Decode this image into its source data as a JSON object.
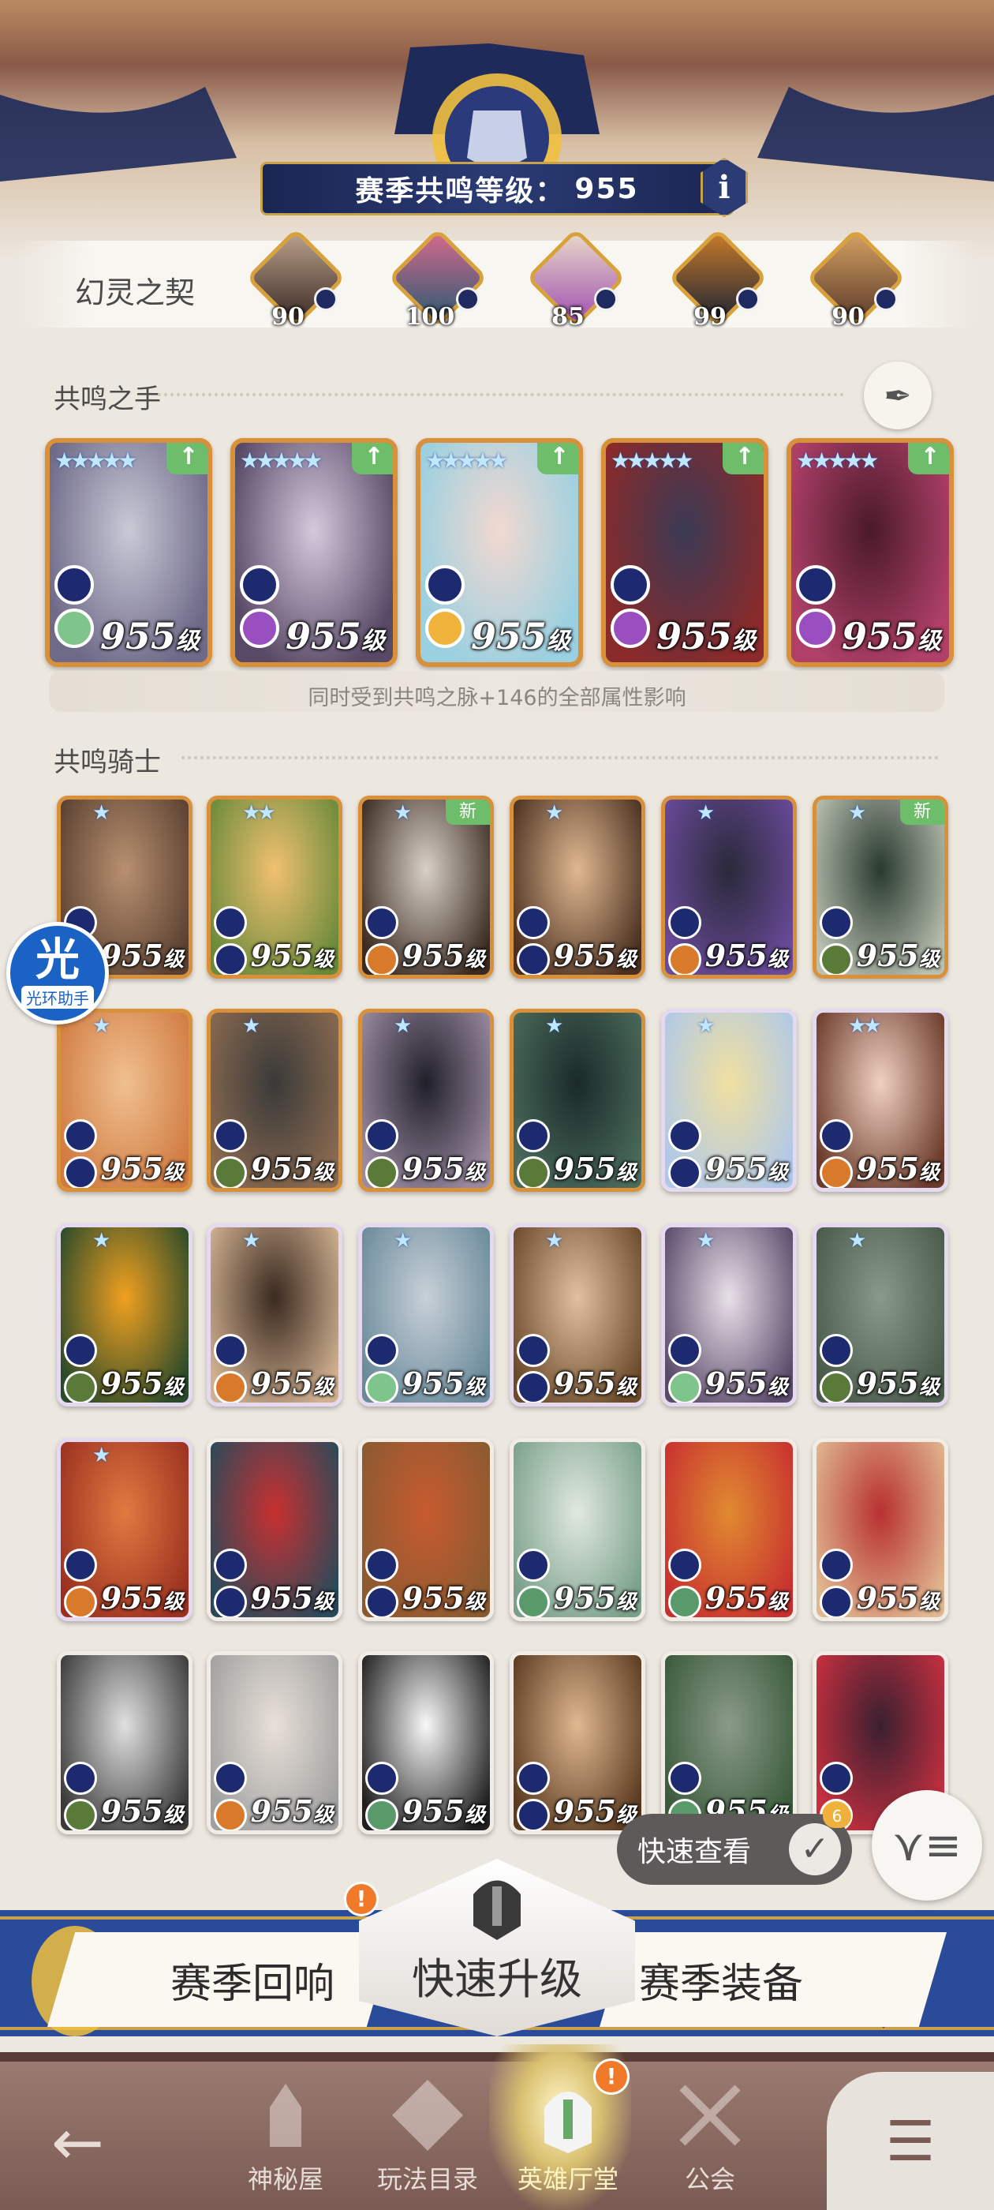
{
  "header": {
    "level_label": "赛季共鸣等级：",
    "level_value": "955",
    "info_glyph": "i"
  },
  "contract": {
    "label": "幻灵之契",
    "phantoms": [
      {
        "level": "90",
        "colors": [
          "#3a2a24",
          "#b9a08a"
        ]
      },
      {
        "level": "100",
        "colors": [
          "#2a5a73",
          "#d46a8a"
        ]
      },
      {
        "level": "85",
        "colors": [
          "#a050b0",
          "#e8d8c8"
        ]
      },
      {
        "level": "99",
        "colors": [
          "#1c2436",
          "#c87a2a"
        ]
      },
      {
        "level": "90",
        "colors": [
          "#5a3a2a",
          "#d4a060"
        ]
      }
    ]
  },
  "resonance_hand": {
    "title": "共鸣之手",
    "shared_text": "同时受到共鸣之脉+146的全部属性影响",
    "cards": [
      {
        "stars": "★★★★★",
        "level": "955",
        "unit": "级",
        "colors": [
          "#c9c9d6",
          "#6e6a88"
        ],
        "fac2": "#7fc48a"
      },
      {
        "stars": "★★★★★",
        "level": "955",
        "unit": "级",
        "colors": [
          "#d6c8dc",
          "#584a66"
        ],
        "fac2": "#9a4fc0"
      },
      {
        "stars": "★★★★★",
        "level": "955",
        "unit": "级",
        "colors": [
          "#f2d8d0",
          "#9ad0e0"
        ],
        "fac2": "#f0b43c"
      },
      {
        "stars": "★★★★★",
        "level": "955",
        "unit": "级",
        "colors": [
          "#3a3a55",
          "#8a2a2a"
        ],
        "fac2": "#9a4fc0"
      },
      {
        "stars": "★★★★★",
        "level": "955",
        "unit": "级",
        "colors": [
          "#4a1a2a",
          "#b04068"
        ],
        "fac2": "#9a4fc0"
      }
    ]
  },
  "resonance_knights": {
    "title": "共鸣骑士",
    "new_tag": "新",
    "rows": [
      [
        {
          "stars": "★",
          "level": "955",
          "unit": "级",
          "style": "gold",
          "colors": [
            "#b89070",
            "#5a4030"
          ],
          "fac2": "#1e2a70",
          "new": false
        },
        {
          "stars": "★★",
          "level": "955",
          "unit": "级",
          "style": "gold",
          "colors": [
            "#f0c070",
            "#6a8a3a"
          ],
          "fac2": "#1e2a70",
          "new": false
        },
        {
          "stars": "★",
          "level": "955",
          "unit": "级",
          "style": "gold",
          "colors": [
            "#d8d0c8",
            "#3a2a20"
          ],
          "fac2": "#d87a2a",
          "new": true
        },
        {
          "stars": "★",
          "level": "955",
          "unit": "级",
          "style": "gold",
          "colors": [
            "#e0b890",
            "#4a3020"
          ],
          "fac2": "#1e2a70",
          "new": false
        },
        {
          "stars": "★",
          "level": "955",
          "unit": "级",
          "style": "gold",
          "colors": [
            "#2a2a3a",
            "#6a4a9a"
          ],
          "fac2": "#d87a2a",
          "new": false
        },
        {
          "stars": "★",
          "level": "955",
          "unit": "级",
          "style": "gold",
          "colors": [
            "#2a3a30",
            "#b8c0b0"
          ],
          "fac2": "#5a7a3a",
          "new": true
        }
      ],
      [
        {
          "stars": "★",
          "level": "955",
          "unit": "级",
          "style": "gold",
          "colors": [
            "#f0c090",
            "#d07a40"
          ],
          "fac2": "#1e2a70",
          "new": false
        },
        {
          "stars": "★",
          "level": "955",
          "unit": "级",
          "style": "gold",
          "colors": [
            "#3a3a3a",
            "#8a6a50"
          ],
          "fac2": "#5a7a3a",
          "new": false
        },
        {
          "stars": "★",
          "level": "955",
          "unit": "级",
          "style": "gold",
          "colors": [
            "#20202a",
            "#9a8aa0"
          ],
          "fac2": "#5a7a3a",
          "new": false
        },
        {
          "stars": "★",
          "level": "955",
          "unit": "级",
          "style": "gold",
          "colors": [
            "#1a2a2a",
            "#4a6a5a"
          ],
          "fac2": "#5a7a3a",
          "new": false
        },
        {
          "stars": "★",
          "level": "955",
          "unit": "级",
          "style": "purple",
          "colors": [
            "#f0e0a0",
            "#b0c8e8"
          ],
          "fac2": "#1e2a70",
          "new": false
        },
        {
          "stars": "★★",
          "level": "955",
          "unit": "级",
          "style": "purple",
          "colors": [
            "#f0d0c0",
            "#6a3a2a"
          ],
          "fac2": "#d87a2a",
          "new": false
        }
      ],
      [
        {
          "stars": "★",
          "level": "955",
          "unit": "级",
          "style": "purple",
          "colors": [
            "#f0a020",
            "#2a4a2a"
          ],
          "fac2": "#5a7a3a",
          "new": false
        },
        {
          "stars": "★",
          "level": "955",
          "unit": "级",
          "style": "purple",
          "colors": [
            "#3a2a20",
            "#d0b090"
          ],
          "fac2": "#d87a2a",
          "new": false
        },
        {
          "stars": "★",
          "level": "955",
          "unit": "级",
          "style": "purple",
          "colors": [
            "#c8d0d8",
            "#6a8a9a"
          ],
          "fac2": "#7fc48a",
          "new": false
        },
        {
          "stars": "★",
          "level": "955",
          "unit": "级",
          "style": "purple",
          "colors": [
            "#e0c0a0",
            "#6a4a2a"
          ],
          "fac2": "#1e2a70",
          "new": false
        },
        {
          "stars": "★",
          "level": "955",
          "unit": "级",
          "style": "purple",
          "colors": [
            "#e8e0e8",
            "#5a4a6a"
          ],
          "fac2": "#7fc48a",
          "new": false
        },
        {
          "stars": "★",
          "level": "955",
          "unit": "级",
          "style": "purple",
          "colors": [
            "#8a9a8a",
            "#4a5a4a"
          ],
          "fac2": "#5a7a3a",
          "new": false
        }
      ],
      [
        {
          "stars": "★",
          "level": "955",
          "unit": "级",
          "style": "purple",
          "colors": [
            "#e07a40",
            "#9a3020"
          ],
          "fac2": "#d87a2a",
          "new": false
        },
        {
          "stars": "",
          "level": "955",
          "unit": "级",
          "style": "red",
          "colors": [
            "#c83030",
            "#2a4a5a"
          ],
          "fac2": "#1e2a70",
          "new": false
        },
        {
          "stars": "",
          "level": "955",
          "unit": "级",
          "style": "red",
          "colors": [
            "#c85a30",
            "#8a5a30"
          ],
          "fac2": "#1e2a70",
          "new": false
        },
        {
          "stars": "",
          "level": "955",
          "unit": "级",
          "style": "red",
          "colors": [
            "#e0e8e0",
            "#7aa08a"
          ],
          "fac2": "#5a9a6a",
          "new": false
        },
        {
          "stars": "",
          "level": "955",
          "unit": "级",
          "style": "red",
          "colors": [
            "#e08a30",
            "#c83030"
          ],
          "fac2": "#5a9a6a",
          "new": false
        },
        {
          "stars": "",
          "level": "955",
          "unit": "级",
          "style": "red",
          "colors": [
            "#b83030",
            "#e0b890"
          ],
          "fac2": "#1e2a70",
          "new": false
        }
      ],
      [
        {
          "stars": "",
          "level": "955",
          "unit": "级",
          "style": "red",
          "colors": [
            "#e0e0e0",
            "#3a3a3a"
          ],
          "fac2": "#5a7a3a",
          "new": false
        },
        {
          "stars": "",
          "level": "955",
          "unit": "级",
          "style": "red",
          "colors": [
            "#e8e0d8",
            "#a0a0a0"
          ],
          "fac2": "#d87a2a",
          "new": false
        },
        {
          "stars": "",
          "level": "955",
          "unit": "级",
          "style": "red",
          "colors": [
            "#f8f8f8",
            "#202020"
          ],
          "fac2": "#5a9a6a",
          "new": false
        },
        {
          "stars": "",
          "level": "955",
          "unit": "级",
          "style": "red",
          "colors": [
            "#e0b890",
            "#5a3a20"
          ],
          "fac2": "#1e2a70",
          "new": false
        },
        {
          "stars": "",
          "level": "955",
          "unit": "级",
          "style": "red",
          "colors": [
            "#8a9a8a",
            "#3a5a3a"
          ],
          "fac2": "#5a9a6a",
          "new": false
        },
        {
          "stars": "",
          "level": "",
          "unit": "",
          "style": "red",
          "colors": [
            "#3a2030",
            "#c83040"
          ],
          "fac2": "#f0b43c",
          "new": false
        }
      ]
    ]
  },
  "assistant": {
    "icon": "光",
    "label": "光环助手"
  },
  "quick_view": {
    "label": "快速查看",
    "check": "✓",
    "badge": "6"
  },
  "filter_glyph": "⋎≡",
  "actions": {
    "season_echo": "赛季回响",
    "quick_upgrade": "快速升级",
    "season_gear": "赛季装备",
    "alert": "!"
  },
  "nav": {
    "back": "←",
    "items": [
      {
        "label": "神秘屋"
      },
      {
        "label": "玩法目录"
      },
      {
        "label": "英雄厅堂"
      },
      {
        "label": "公会"
      }
    ],
    "alert": "!",
    "menu": "☰"
  },
  "colors": {
    "navy": "#1a2652",
    "gold": "#c8a24a",
    "green_tag": "#6dbd6a",
    "alert_orange": "#f07a2a"
  }
}
